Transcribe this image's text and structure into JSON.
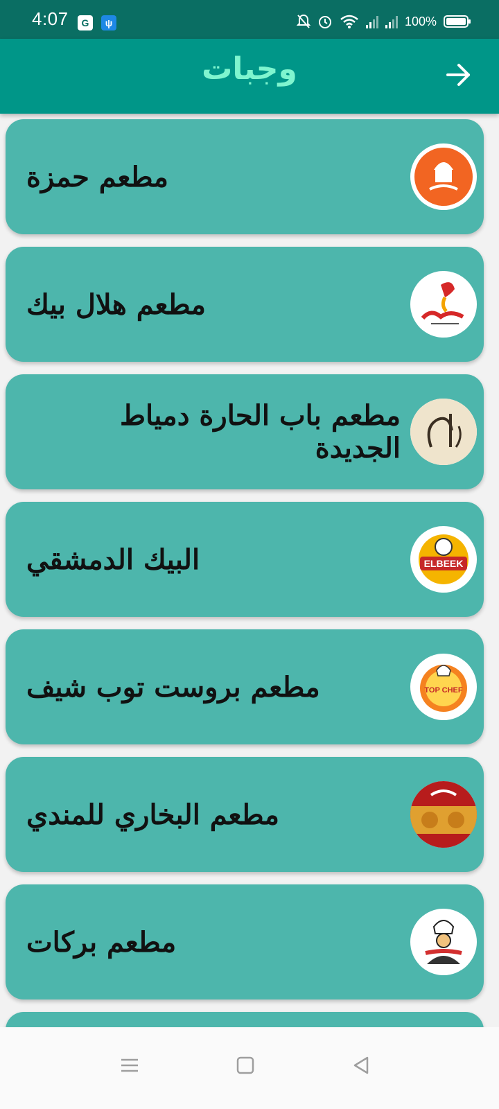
{
  "status_bar": {
    "time": "4:07",
    "battery": "100%"
  },
  "app_bar": {
    "title": "وجبات",
    "back_icon": "arrow-back-icon"
  },
  "restaurants": [
    {
      "name": "مطعم حمزة",
      "logo": "hamza-logo"
    },
    {
      "name": "مطعم هلال بيك",
      "logo": "helal-beek-logo"
    },
    {
      "name": "مطعم باب الحارة دمياط الجديدة",
      "logo": "bab-elhara-logo"
    },
    {
      "name": "البيك الدمشقي",
      "logo": "elbeek-logo"
    },
    {
      "name": "مطعم بروست توب شيف",
      "logo": "top-chef-logo"
    },
    {
      "name": "مطعم البخاري للمندي",
      "logo": "elbukhari-logo"
    },
    {
      "name": "مطعم بركات",
      "logo": "barakat-logo"
    }
  ],
  "colors": {
    "status_bar": "#0a6e63",
    "app_bar": "#009688",
    "title": "#7ff5cf",
    "card": "#4db6ac"
  }
}
